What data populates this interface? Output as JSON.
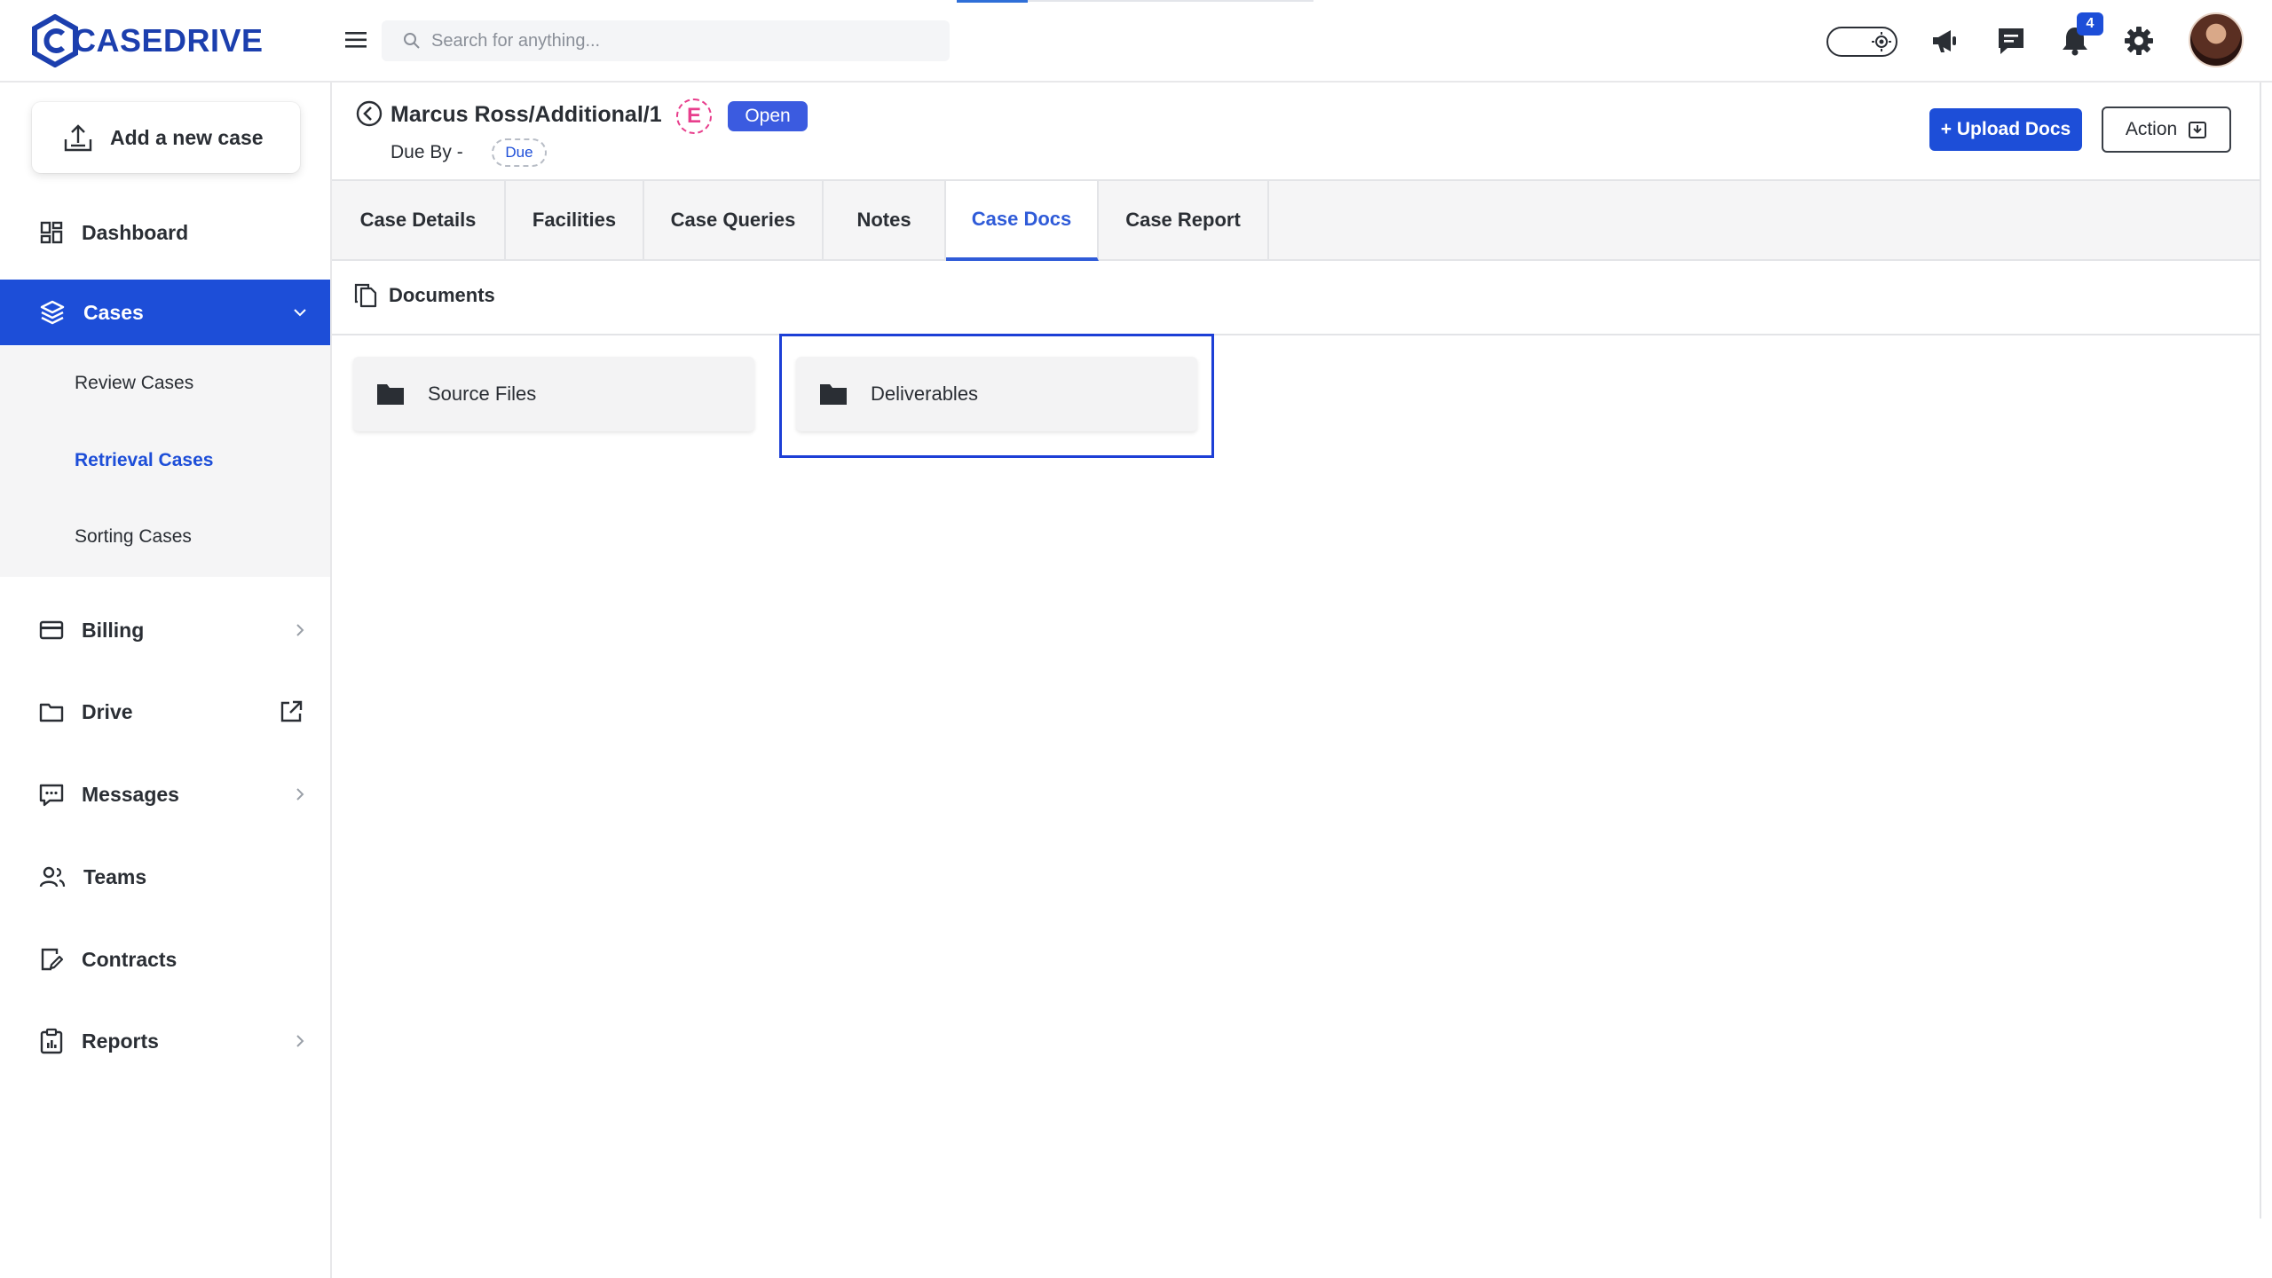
{
  "app": {
    "logo_text": "CASEDRIVE",
    "brand_color": "#1c3fae",
    "accent_color": "#1d4ed8"
  },
  "topbar": {
    "search_placeholder": "Search for anything...",
    "notifications_count": "4",
    "icons": [
      "menu-icon",
      "search-icon",
      "theme-toggle",
      "megaphone-icon",
      "chat-icon",
      "bell-icon",
      "gear-icon",
      "avatar"
    ]
  },
  "sidebar": {
    "add_case_label": "Add a new case",
    "items": [
      {
        "label": "Dashboard",
        "icon": "dashboard-icon"
      },
      {
        "label": "Cases",
        "icon": "layers-icon",
        "active": true
      },
      {
        "label": "Billing",
        "icon": "card-icon"
      },
      {
        "label": "Drive",
        "icon": "folder-icon"
      },
      {
        "label": "Messages",
        "icon": "message-icon"
      },
      {
        "label": "Teams",
        "icon": "team-icon"
      },
      {
        "label": "Contracts",
        "icon": "contract-icon"
      },
      {
        "label": "Reports",
        "icon": "report-icon"
      }
    ],
    "cases_sub": [
      {
        "label": "Review Cases"
      },
      {
        "label": "Retrieval Cases",
        "active": true
      },
      {
        "label": "Sorting Cases"
      }
    ]
  },
  "case": {
    "title": "Marcus Ross/Additional/1",
    "e_badge": "E",
    "status": "Open",
    "due_by_label": "Due By -",
    "due_badge": "Due",
    "upload_label": "+ Upload Docs",
    "action_label": "Action"
  },
  "tabs": [
    {
      "label": "Case Details"
    },
    {
      "label": "Facilities"
    },
    {
      "label": "Case Queries"
    },
    {
      "label": "Notes"
    },
    {
      "label": "Case Docs",
      "active": true
    },
    {
      "label": "Case Report"
    }
  ],
  "documents": {
    "heading": "Documents",
    "folders": [
      {
        "label": "Source Files"
      },
      {
        "label": "Deliverables",
        "selected": true
      }
    ]
  }
}
